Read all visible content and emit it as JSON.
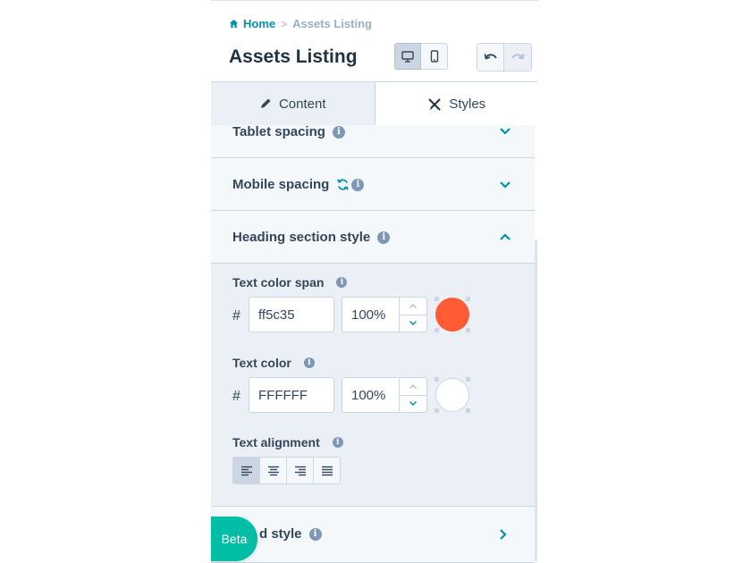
{
  "breadcrumb": {
    "home": "Home",
    "separator": ">",
    "current": "Assets Listing"
  },
  "header": {
    "title": "Assets Listing"
  },
  "tabs": [
    {
      "label": "Content",
      "icon": "pencil-icon",
      "active": false
    },
    {
      "label": "Styles",
      "icon": "styles-icon",
      "active": true
    }
  ],
  "sections": {
    "tablet_spacing": "Tablet spacing",
    "mobile_spacing": "Mobile spacing",
    "heading_section_style": "Heading section style",
    "card_style_visible": "d style"
  },
  "fields": {
    "text_color_span": {
      "label": "Text color span",
      "hash": "#",
      "hex": "ff5c35",
      "opacity": "100%",
      "swatch": "#ff5c35"
    },
    "text_color": {
      "label": "Text color",
      "hash": "#",
      "hex": "FFFFFF",
      "opacity": "100%",
      "swatch": "#ffffff"
    },
    "text_alignment": {
      "label": "Text alignment",
      "options": [
        "left",
        "center",
        "right",
        "justify"
      ],
      "selected": "left"
    }
  },
  "info_glyph": "i",
  "beta": "Beta",
  "colors": {
    "accent": "#0091ae",
    "text": "#33475b",
    "beta": "#00bda5"
  }
}
